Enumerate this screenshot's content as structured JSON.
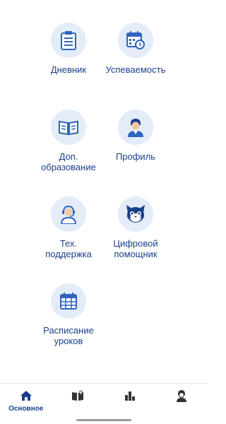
{
  "menu": {
    "diary": {
      "label": "Дневник",
      "icon": "diary-clipboard-icon"
    },
    "progress": {
      "label": "Успеваемость",
      "icon": "calendar-clock-icon"
    },
    "education": {
      "label": "Доп.\nобразование",
      "icon": "open-book-icon"
    },
    "profile": {
      "label": "Профиль",
      "icon": "user-avatar-icon"
    },
    "support": {
      "label": "Тех.\nподдержка",
      "icon": "support-headset-icon"
    },
    "assistant": {
      "label": "Цифровой\nпомощник",
      "icon": "cat-assistant-icon"
    },
    "schedule": {
      "label": "Расписание\nуроков",
      "icon": "calendar-grid-icon"
    }
  },
  "bottom_nav": {
    "home_label": "Основное",
    "items": [
      "home-icon",
      "book-icon",
      "bar-chart-icon",
      "user-icon"
    ]
  },
  "colors": {
    "accent": "#1a3f8a",
    "icon_blue": "#2f64c0",
    "icon_bg": "#e3ecf8"
  }
}
